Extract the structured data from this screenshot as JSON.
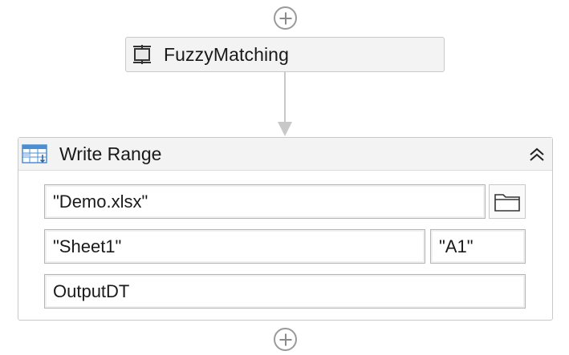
{
  "sequence": {
    "previous_activity": {
      "title": "FuzzyMatching",
      "icon": "fuzzy-matching-icon"
    },
    "write_range": {
      "title": "Write Range",
      "icon": "spreadsheet-icon",
      "collapse_icon": "double-chevron-up-icon",
      "workbook_path": "\"Demo.xlsx\"",
      "browse_icon": "folder-icon",
      "sheet_name": "\"Sheet1\"",
      "starting_cell": "\"A1\"",
      "data_table": "OutputDT"
    },
    "add_activity_icon": "plus-circle-icon"
  },
  "colors": {
    "header_bg": "#f3f3f3",
    "border": "#c9c9c9",
    "connector": "#c8c8c8",
    "spreadsheet_blue": "#4a8fd4"
  }
}
